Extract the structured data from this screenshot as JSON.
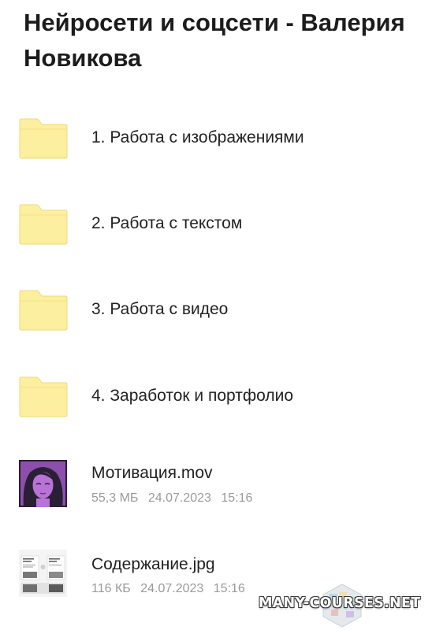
{
  "page": {
    "title": "Нейросети и соцсети - Валерия Новикова"
  },
  "colors": {
    "folder_fill": "#fcef9f",
    "folder_stroke": "#efd87a",
    "meta_text": "#9b9b9b",
    "thumb_purple": "#9a5ab8"
  },
  "folders": [
    {
      "label": "1. Работа с изображениями",
      "icon": "folder-icon"
    },
    {
      "label": "2. Работа с текстом",
      "icon": "folder-icon"
    },
    {
      "label": "3. Работа с видео",
      "icon": "folder-icon"
    },
    {
      "label": "4. Заработок и портфолио",
      "icon": "folder-icon"
    }
  ],
  "files": [
    {
      "name": "Мотивация.mov",
      "size": "55,3 МБ",
      "date": "24.07.2023",
      "time": "15:16",
      "icon": "video-thumbnail"
    },
    {
      "name": "Содержание.jpg",
      "size": "116 КБ",
      "date": "24.07.2023",
      "time": "15:16",
      "icon": "image-thumbnail"
    }
  ],
  "watermark": {
    "text": "MANY-COURSES.NET"
  }
}
